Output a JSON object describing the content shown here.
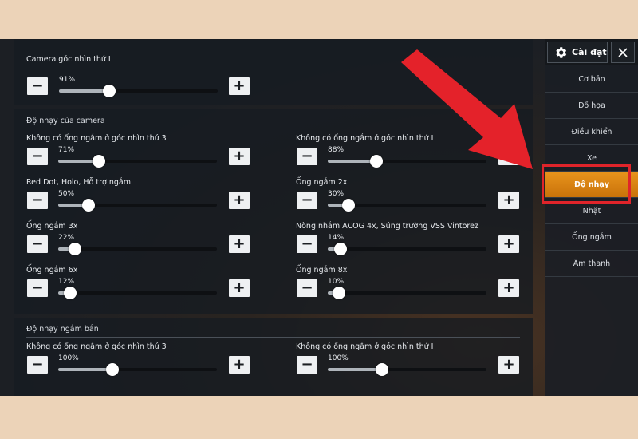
{
  "sidebar": {
    "title": "Cài đặt",
    "items": [
      {
        "label": "Cơ bản"
      },
      {
        "label": "Đồ họa"
      },
      {
        "label": "Điều khiển"
      },
      {
        "label": "Xe"
      },
      {
        "label": "Độ nhạy",
        "active": true
      },
      {
        "label": "Nhặt"
      },
      {
        "label": "Ống ngắm"
      },
      {
        "label": "Âm thanh"
      }
    ]
  },
  "camera": {
    "row": {
      "label": "Camera góc nhìn thứ I",
      "value": "91%",
      "level": 0.91
    }
  },
  "camera_sensitivity": {
    "title": "Độ nhạy của camera",
    "rows": [
      {
        "label": "Không có ống ngắm ở góc nhìn thứ 3",
        "value": "71%",
        "level": 0.71
      },
      {
        "label": "Không có ống ngắm ở góc nhìn thứ I",
        "value": "88%",
        "level": 0.88
      },
      {
        "label": "Red Dot, Holo, Hỗ trợ ngắm",
        "value": "50%",
        "level": 0.5
      },
      {
        "label": "Ống ngắm 2x",
        "value": "30%",
        "level": 0.3
      },
      {
        "label": "Ống ngắm 3x",
        "value": "22%",
        "level": 0.22
      },
      {
        "label": "Nòng nhắm ACOG 4x, Súng trường VSS Vintorez",
        "value": "14%",
        "level": 0.14
      },
      {
        "label": "Ống ngắm 6x",
        "value": "12%",
        "level": 0.12
      },
      {
        "label": "Ống ngắm 8x",
        "value": "10%",
        "level": 0.1
      }
    ]
  },
  "ads_sensitivity": {
    "title": "Độ nhạy ngắm bắn",
    "rows": [
      {
        "label": "Không có ống ngắm ở góc nhìn thứ 3",
        "value": "100%",
        "level": 1.0
      },
      {
        "label": "Không có ống ngắm ở góc nhìn thứ I",
        "value": "100%",
        "level": 1.0
      }
    ]
  },
  "colors": {
    "accent": "#e8941c",
    "annotation": "#e0242a"
  }
}
